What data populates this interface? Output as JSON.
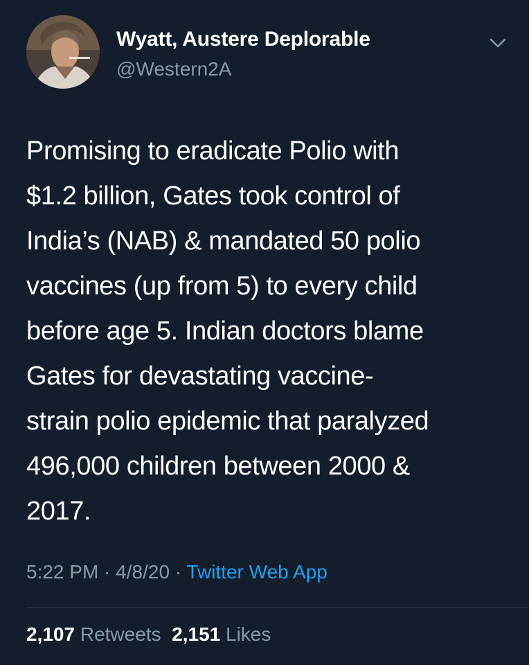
{
  "author": {
    "display_name": "Wyatt, Austere Deplorable",
    "handle": "@Western2A"
  },
  "tweet": {
    "lines": [
      "Promising to eradicate Polio with",
      "$1.2 billion, Gates took control of",
      "India’s (NAB) & mandated 50 polio",
      "vaccines (up from 5) to every child",
      "before age 5. Indian doctors blame",
      "Gates for devastating vaccine-",
      "strain polio epidemic that paralyzed",
      "496,000 children between 2000 &",
      "2017."
    ]
  },
  "meta": {
    "time": "5:22 PM",
    "sep1": " · ",
    "date": "4/8/20",
    "sep2": " · ",
    "source": "Twitter Web App"
  },
  "stats": {
    "retweets_count": "2,107",
    "retweets_label": "Retweets",
    "likes_count": "2,151",
    "likes_label": "Likes"
  },
  "colors": {
    "background": "#141d2b",
    "secondary_text": "#8899a6",
    "link": "#1da1f2"
  },
  "icons": {
    "menu": "chevron-down-icon"
  }
}
